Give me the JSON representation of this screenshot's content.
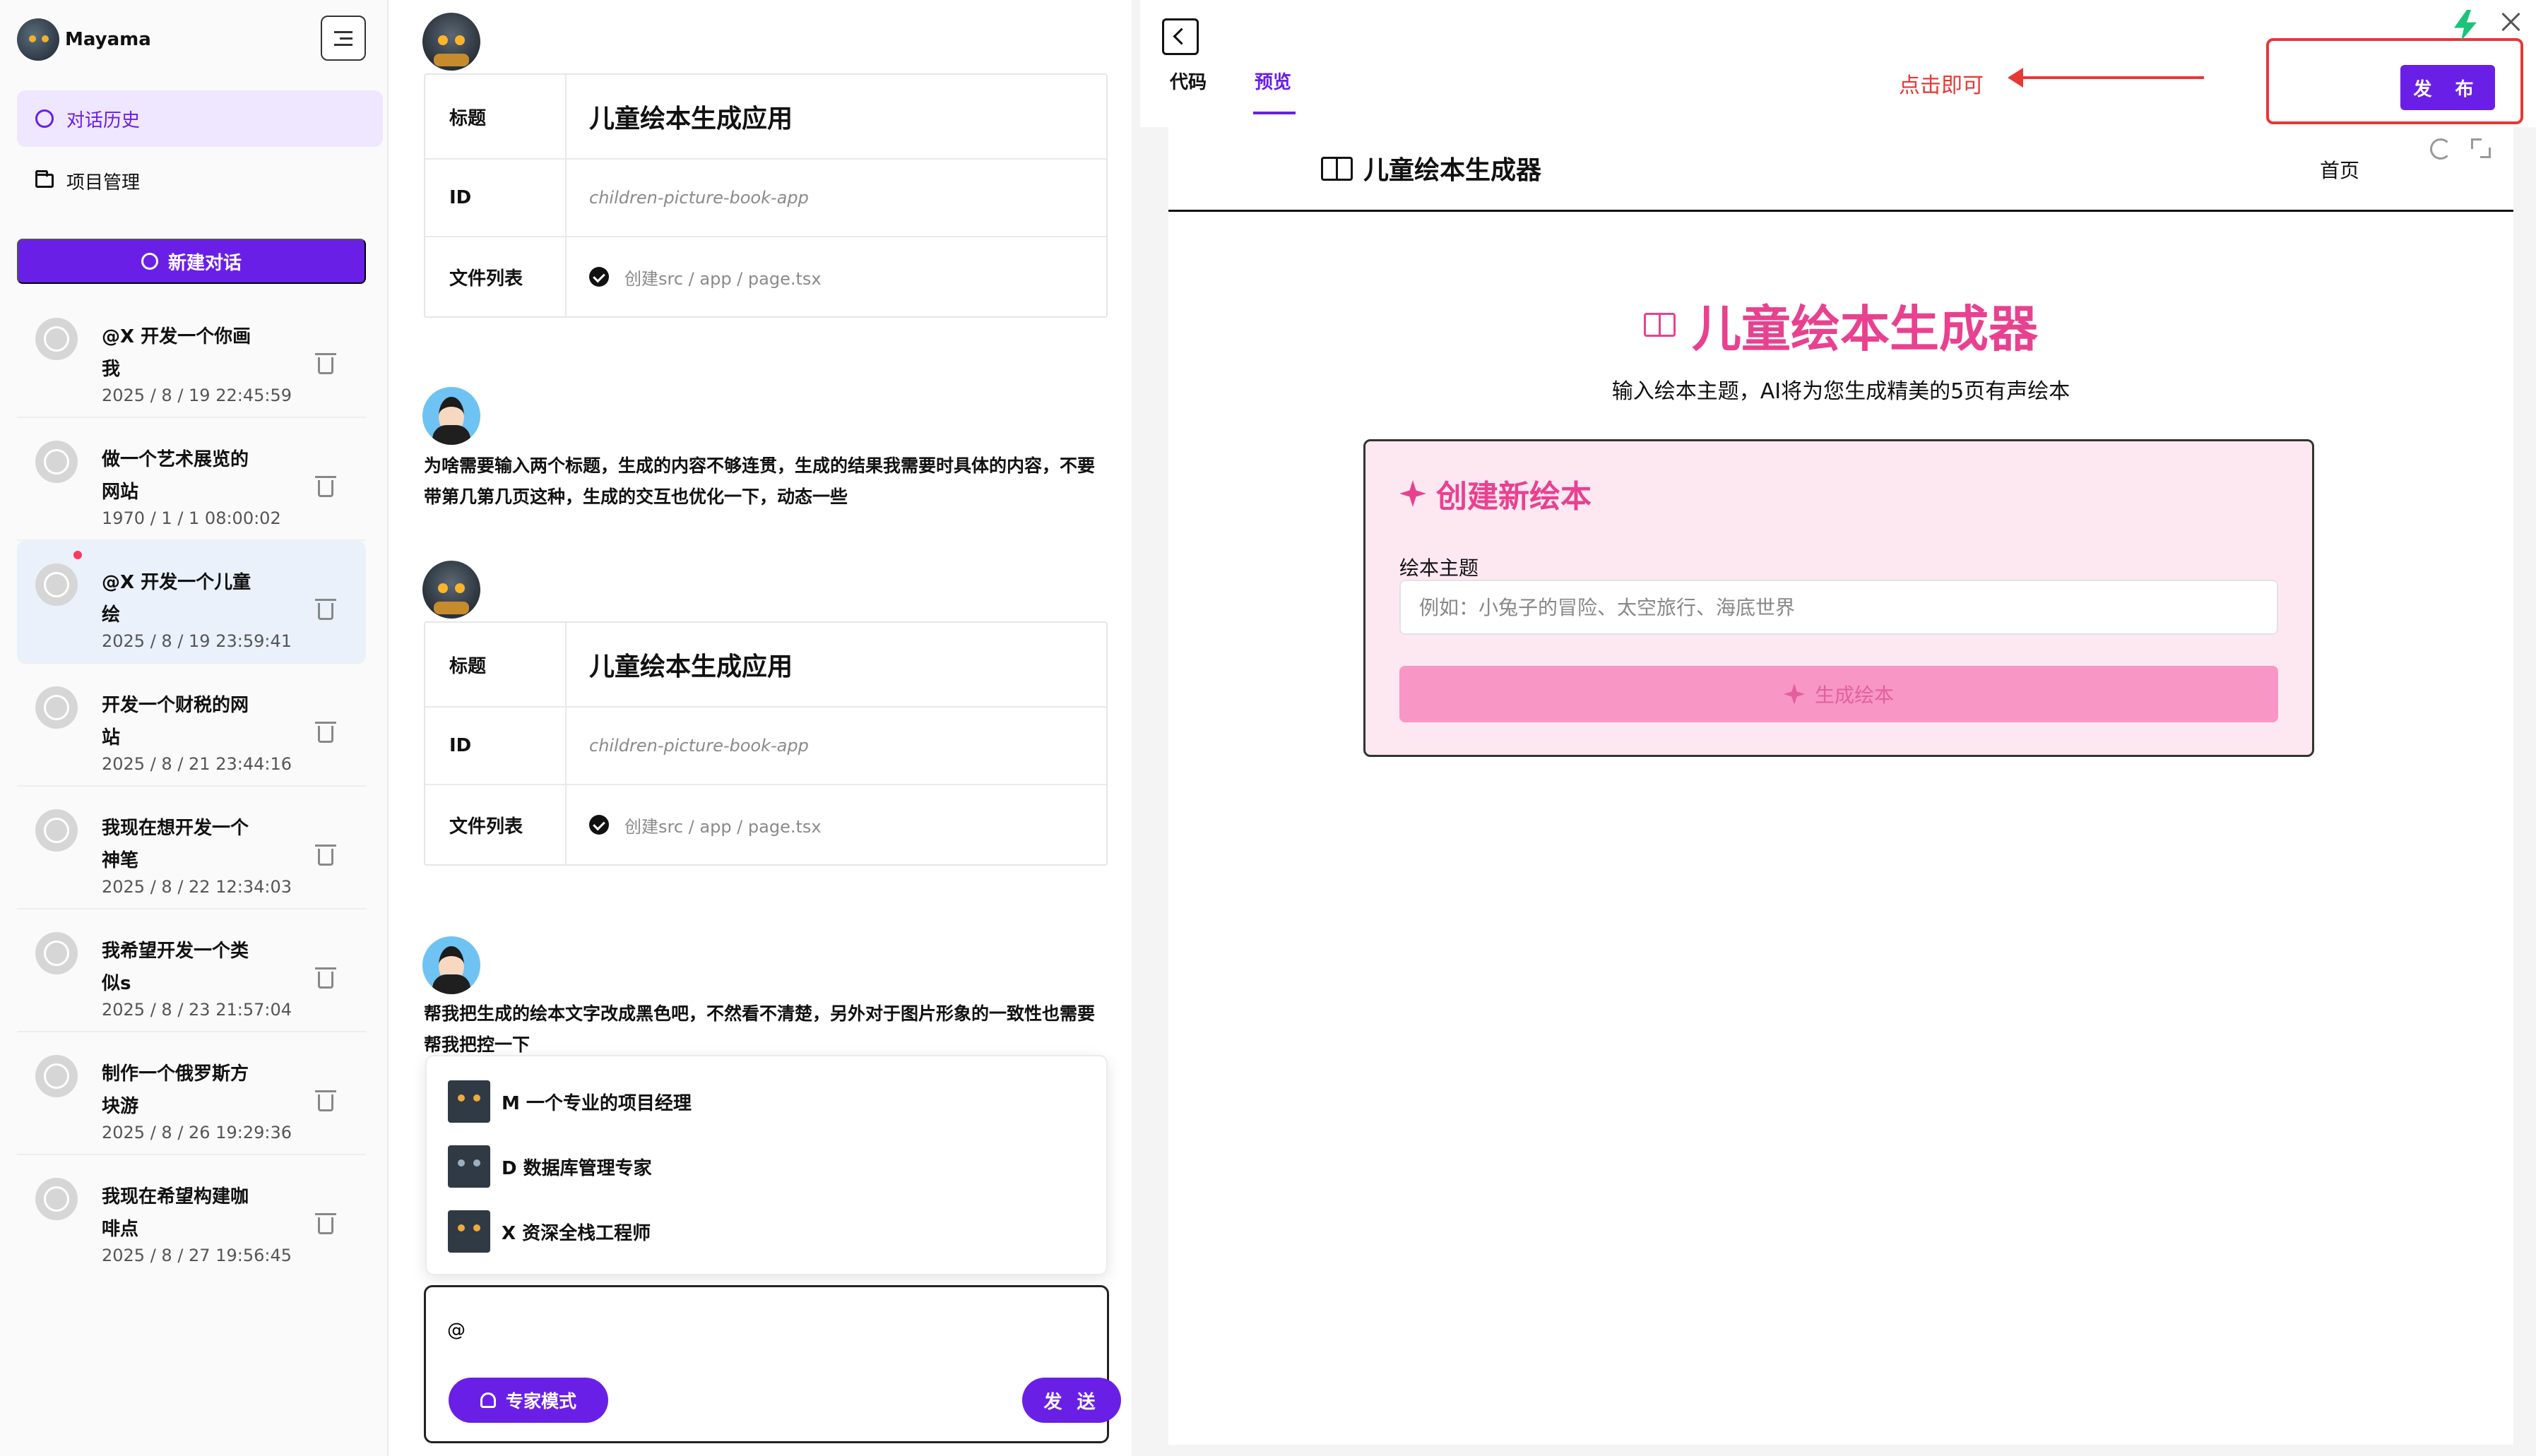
{
  "sidebar": {
    "brand": "Mayama",
    "nav": {
      "history": "对话历史",
      "projects": "项目管理"
    },
    "new_chat": "新建对话",
    "history": [
      {
        "title": "@X 开发一个你画我",
        "time": "2025 / 8 / 19 22:45:59"
      },
      {
        "title": "做一个艺术展览的网站",
        "time": "1970 / 1 / 1 08:00:02"
      },
      {
        "title": "@X 开发一个儿童绘",
        "time": "2025 / 8 / 19 23:59:41"
      },
      {
        "title": "开发一个财税的网站",
        "time": "2025 / 8 / 21 23:44:16"
      },
      {
        "title": "我现在想开发一个神笔",
        "time": "2025 / 8 / 22 12:34:03"
      },
      {
        "title": "我希望开发一个类似s",
        "time": "2025 / 8 / 23 21:57:04"
      },
      {
        "title": "制作一个俄罗斯方块游",
        "time": "2025 / 8 / 26 19:29:36"
      },
      {
        "title": "我现在希望构建咖啡点",
        "time": "2025 / 8 / 27 19:56:45"
      }
    ]
  },
  "chat": {
    "cards": [
      {
        "title_label": "标题",
        "title_value": "儿童绘本生成应用",
        "id_label": "ID",
        "id_value": "children-picture-book-app",
        "files_label": "文件列表",
        "file": "创建src / app / page.tsx"
      },
      {
        "title_label": "标题",
        "title_value": "儿童绘本生成应用",
        "id_label": "ID",
        "id_value": "children-picture-book-app",
        "files_label": "文件列表",
        "file": "创建src / app / page.tsx"
      }
    ],
    "user_messages": [
      "为啥需要输入两个标题，生成的内容不够连贯，生成的结果我需要时具体的内容，不要带第几第几页这种，生成的交互也优化一下，动态一些",
      "帮我把生成的绘本文字改成黑色吧，不然看不清楚，另外对于图片形象的一致性也需要帮我把控一下"
    ],
    "mentions": [
      {
        "label": "M 一个专业的项目经理"
      },
      {
        "label": "D 数据库管理专家"
      },
      {
        "label": "X 资深全栈工程师"
      }
    ],
    "composer": {
      "value": "@",
      "expert_mode": "专家模式",
      "send": "发 送"
    }
  },
  "panel": {
    "tabs": {
      "code": "代码",
      "preview": "预览"
    },
    "annotation": "点击即可",
    "publish": "发 布",
    "app": {
      "brand": "儿童绘本生成器",
      "nav_home": "首页",
      "hero_title": "儿童绘本生成器",
      "hero_subtitle": "输入绘本主题，AI将为您生成精美的5页有声绘本",
      "card_title": "创建新绘本",
      "field_label": "绘本主题",
      "field_placeholder": "例如：小兔子的冒险、太空旅行、海底世界",
      "generate": "生成绘本"
    }
  },
  "colors": {
    "accent": "#6a1fe6",
    "pink": "#e8418f",
    "annotation_red": "#e53935"
  }
}
